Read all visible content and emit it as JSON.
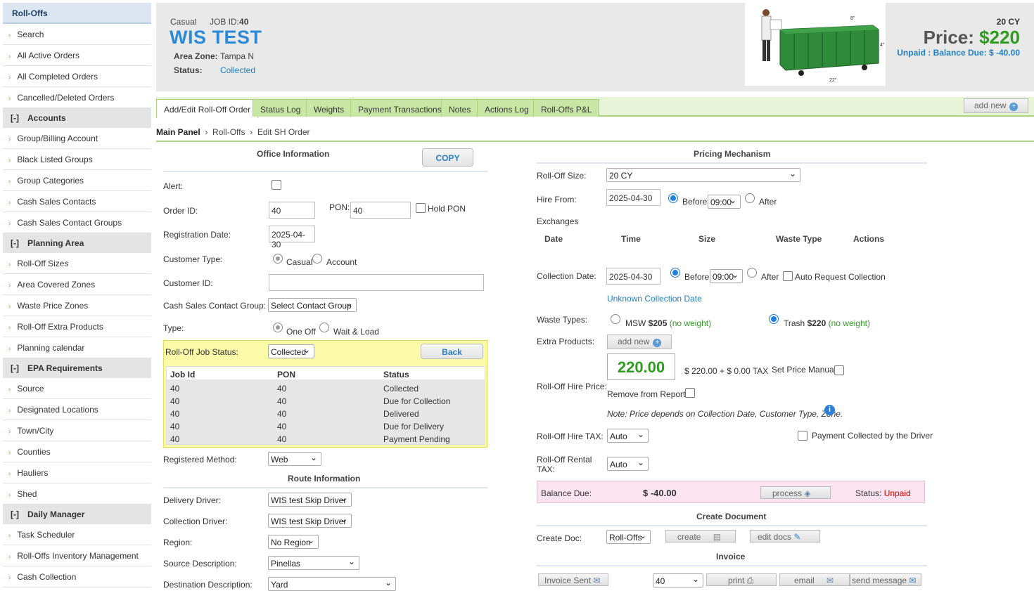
{
  "sidebar": {
    "top": "Roll-Offs",
    "group1": [
      "Search",
      "All Active Orders",
      "All Completed Orders",
      "Cancelled/Deleted Orders"
    ],
    "sec_accounts": "Accounts",
    "group2": [
      "Group/Billing Account",
      "Black Listed Groups",
      "Group Categories",
      "Cash Sales Contacts",
      "Cash Sales Contact Groups"
    ],
    "sec_planning": "Planning Area",
    "group3": [
      "Roll-Off Sizes",
      "Area Covered Zones",
      "Waste Price Zones",
      "Roll-Off Extra Products",
      "Planning calendar"
    ],
    "sec_epa": "EPA Requirements",
    "group4": [
      "Source",
      "Designated Locations",
      "Town/City",
      "Counties",
      "Hauliers",
      "Shed"
    ],
    "sec_daily": "Daily Manager",
    "group5": [
      "Task Scheduler",
      "Roll-Offs Inventory Management",
      "Cash Collection"
    ],
    "toggle": "[-]"
  },
  "header": {
    "type": "Casual",
    "jobid_label": "JOB ID:",
    "jobid": "40",
    "title": "WIS TEST",
    "area_label": "Area Zone:",
    "area": "Tampa N",
    "status_label": "Status:",
    "status": "Collected",
    "size": "20 CY",
    "price_label": "Price:",
    "price": "$220",
    "unpaid": "Unpaid : Balance Due: $ -40.00",
    "img_dims": [
      "8\"",
      "4\"",
      "22\""
    ]
  },
  "tabs": [
    "Add/Edit Roll-Off Order",
    "Status Log",
    "Weights",
    "Payment Transactions",
    "Notes",
    "Actions Log",
    "Roll-Offs P&L"
  ],
  "add_new": "add new",
  "crumb": {
    "main": "Main Panel",
    "a": "Roll-Offs",
    "b": "Edit SH Order",
    "sep": "›"
  },
  "office": {
    "title": "Office Information",
    "copy": "COPY",
    "alert": "Alert:",
    "order_id_label": "Order ID:",
    "order_id": "40",
    "pon_label": "PON:",
    "pon": "40",
    "hold_pon": "Hold PON",
    "reg_date_label": "Registration Date:",
    "reg_date": "2025-04-30",
    "cust_type_label": "Customer Type:",
    "casual": "Casual",
    "account": "Account",
    "cust_id_label": "Customer ID:",
    "contact_group_label": "Cash Sales Contact Group:",
    "contact_group": "Select Contact Group",
    "type_label": "Type:",
    "one_off": "One Off",
    "wait_load": "Wait & Load",
    "job_status_label": "Roll-Off Job Status:",
    "job_status": "Collected",
    "back": "Back",
    "table_head": [
      "Job Id",
      "PON",
      "Status"
    ],
    "table_rows": [
      [
        "40",
        "40",
        "Collected"
      ],
      [
        "40",
        "40",
        "Due for Collection"
      ],
      [
        "40",
        "40",
        "Delivered"
      ],
      [
        "40",
        "40",
        "Due for Delivery"
      ],
      [
        "40",
        "40",
        "Payment Pending"
      ]
    ],
    "reg_method_label": "Registered Method:",
    "reg_method": "Web"
  },
  "route": {
    "title": "Route Information",
    "delivery_label": "Delivery Driver:",
    "delivery": "WIS test Skip Driver",
    "collection_label": "Collection Driver:",
    "collection": "WIS test Skip Driver",
    "region_label": "Region:",
    "region": "No Region",
    "source_label": "Source Description:",
    "source": "Pinellas",
    "dest_label": "Destination Description:",
    "dest": "Yard"
  },
  "pricing": {
    "title": "Pricing Mechanism",
    "size_label": "Roll-Off Size:",
    "size": "20 CY",
    "hire_label": "Hire From:",
    "hire_date": "2025-04-30",
    "before": "Before",
    "hire_time": "09:00",
    "after": "After",
    "exchanges": "Exchanges",
    "ex_head": [
      "Date",
      "Time",
      "Size",
      "Waste Type",
      "Actions"
    ],
    "coll_label": "Collection Date:",
    "coll_date": "2025-04-30",
    "coll_time": "09:00",
    "auto_req": "Auto Request Collection",
    "unknown": "Unknown Collection Date",
    "waste_label": "Waste Types:",
    "msw": "MSW",
    "msw_price": "$205",
    "no_weight": "(no weight)",
    "trash": "Trash",
    "trash_price": "$220",
    "extra_label": "Extra Products:",
    "hire_price_label": "Roll-Off Hire Price:",
    "hire_price": "220.00",
    "tax_text": "$ 220.00 + $ 0.00 TAX",
    "set_manual": "Set Price Manually",
    "remove": "Remove from Reports",
    "note": "Note: Price depends on Collection Date, Customer Type, Zone.",
    "hire_tax_label": "Roll-Off Hire TAX:",
    "hire_tax": "Auto",
    "driver_paid": "Payment Collected by the Driver",
    "rental_tax_label": "Roll-Off Rental TAX:",
    "rental_tax": "Auto",
    "balance_label": "Balance Due:",
    "balance": "$ -40.00",
    "process": "process",
    "status_label": "Status:",
    "status": "Unpaid"
  },
  "document": {
    "title": "Create Document",
    "label": "Create Doc:",
    "doc": "Roll-Offs",
    "create": "create",
    "edit": "edit docs"
  },
  "invoice": {
    "title": "Invoice",
    "sent": "Invoice Sent",
    "num": "40",
    "print": "print",
    "email": "email",
    "send": "send message"
  },
  "colors": {
    "accent": "#2a8ad8",
    "green": "#2e9c1f",
    "tab": "#c8e6a4",
    "unpaid": "#e00000"
  }
}
